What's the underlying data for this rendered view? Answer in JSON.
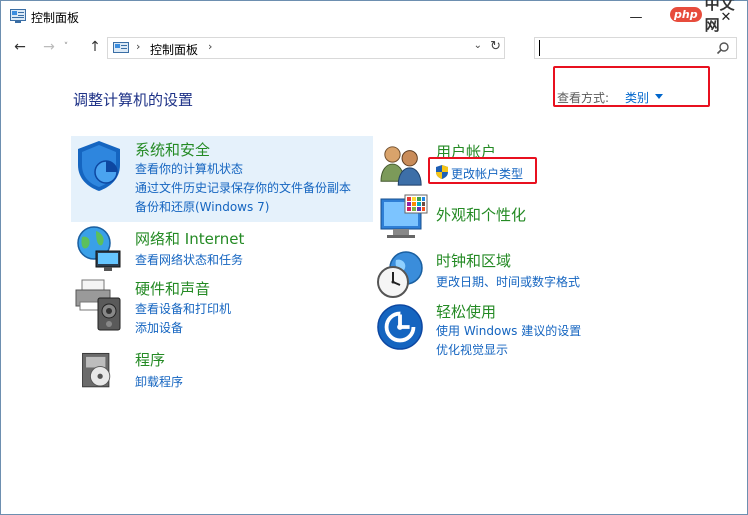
{
  "window": {
    "title": "控制面板",
    "controls": {
      "minimize": "—",
      "maximize": "☐",
      "close": "✕"
    },
    "watermark": {
      "logo": "php",
      "text": "中文网"
    }
  },
  "address_bar": {
    "path": "控制面板",
    "separator": "›"
  },
  "search": {
    "placeholder": "",
    "value": ""
  },
  "header": {
    "title": "调整计算机的设置",
    "view_by_label": "查看方式:",
    "view_by_value": "类别"
  },
  "categories": {
    "security": {
      "title": "系统和安全",
      "links": [
        "查看你的计算机状态",
        "通过文件历史记录保存你的文件备份副本",
        "备份和还原(Windows 7)"
      ]
    },
    "network": {
      "title": "网络和 Internet",
      "links": [
        "查看网络状态和任务"
      ]
    },
    "hardware": {
      "title": "硬件和声音",
      "links": [
        "查看设备和打印机",
        "添加设备"
      ]
    },
    "programs": {
      "title": "程序",
      "links": [
        "卸载程序"
      ]
    },
    "accounts": {
      "title": "用户帐户",
      "links": [
        "更改帐户类型"
      ]
    },
    "appearance": {
      "title": "外观和个性化",
      "links": []
    },
    "clock": {
      "title": "时钟和区域",
      "links": [
        "更改日期、时间或数字格式"
      ]
    },
    "ease": {
      "title": "轻松使用",
      "links": [
        "使用 Windows 建议的设置",
        "优化视觉显示"
      ]
    }
  },
  "colors": {
    "category_title": "#248a24",
    "link": "#1565c0",
    "page_title": "#1e3287",
    "highlight": "#e5f1fb",
    "annotation": "#e8101f"
  }
}
